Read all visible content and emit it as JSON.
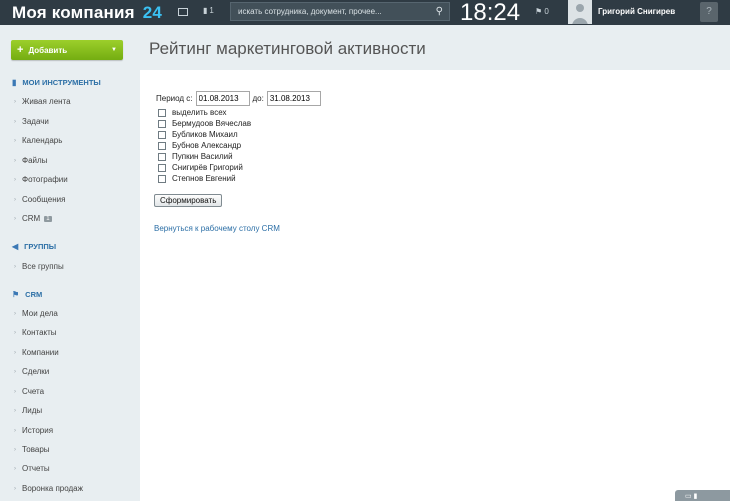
{
  "header": {
    "logo_text": "Моя компания",
    "logo_num": "24",
    "badge_tasks": "1",
    "search_placeholder": "искать сотрудника, документ, прочее...",
    "clock": "18:24",
    "flag_count": "0",
    "username": "Григорий Снигирев",
    "help": "?"
  },
  "sidebar": {
    "add_button": "Добавить",
    "tools_title": "МОИ ИНСТРУМЕНТЫ",
    "tools": [
      "Живая лента",
      "Задачи",
      "Календарь",
      "Файлы",
      "Фотографии",
      "Сообщения",
      "CRM"
    ],
    "crm_badge": "1",
    "groups_title": "ГРУППЫ",
    "groups": [
      "Все группы"
    ],
    "crm_title": "CRM",
    "crm_items": [
      "Мои дела",
      "Контакты",
      "Компании",
      "Сделки",
      "Счета",
      "Лиды",
      "История",
      "Товары",
      "Отчеты",
      "Воронка продаж"
    ]
  },
  "main": {
    "title": "Рейтинг маркетинговой активности",
    "period_label": "Период с:",
    "date_from": "01.08.2013",
    "to_label": "до:",
    "date_to": "31.08.2013",
    "checkboxes": [
      "выделить всех",
      "Бермудоов Вячеслав",
      "Бубликов Михаил",
      "Бубнов Александр",
      "Пупкин Василий",
      "Снигирёв Григорий",
      "Степнов Евгений"
    ],
    "generate_button": "Сформировать",
    "back_link": "Вернуться к рабочему столу CRM"
  }
}
